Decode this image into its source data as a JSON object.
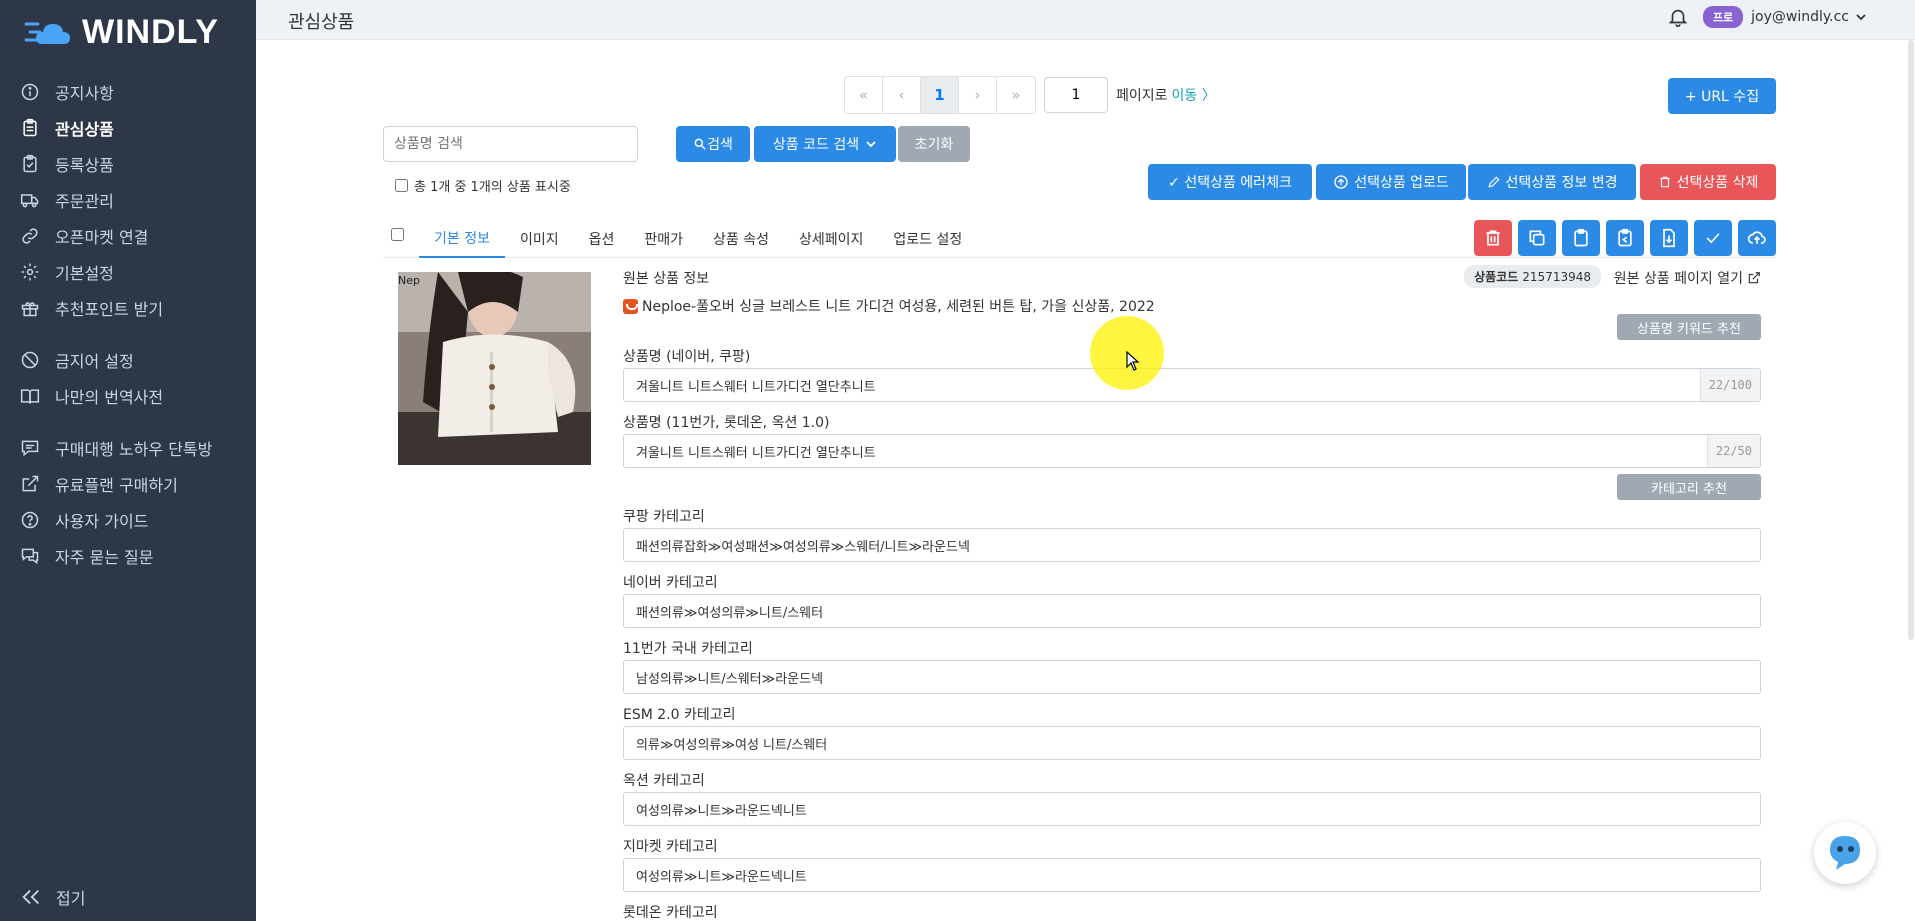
{
  "brand": {
    "logo_text": "WINDLY"
  },
  "sidebar": {
    "items": [
      {
        "label": "공지사항",
        "icon": "info-icon"
      },
      {
        "label": "관심상품",
        "icon": "clipboard-icon",
        "active": true
      },
      {
        "label": "등록상품",
        "icon": "clipboard-check-icon"
      },
      {
        "label": "주문관리",
        "icon": "truck-icon"
      },
      {
        "label": "오픈마켓 연결",
        "icon": "link-icon"
      },
      {
        "label": "기본설정",
        "icon": "gear-icon"
      },
      {
        "label": "추천포인트 받기",
        "icon": "gift-icon"
      },
      {
        "label": "금지어 설정",
        "icon": "ban-icon"
      },
      {
        "label": "나만의 번역사전",
        "icon": "book-icon"
      },
      {
        "label": "구매대행 노하우 단톡방",
        "icon": "chat-icon"
      },
      {
        "label": "유료플랜 구매하기",
        "icon": "external-link-icon"
      },
      {
        "label": "사용자 가이드",
        "icon": "question-icon"
      },
      {
        "label": "자주 묻는 질문",
        "icon": "comments-icon"
      }
    ],
    "collapse_label": "접기"
  },
  "header": {
    "title": "관심상품",
    "badge": "프로",
    "user_email": "joy@windly.cc"
  },
  "pagination": {
    "first": "«",
    "prev": "‹",
    "current": "1",
    "next": "›",
    "last": "»",
    "page_input": "1",
    "page_label": "페이지로",
    "go_label": "이동 〉"
  },
  "toolbar": {
    "url_collect": "+ URL 수집",
    "search_placeholder": "상품명 검색",
    "search_button": "검색",
    "code_search": "상품 코드 검색",
    "reset": "초기화",
    "total_text": "총 1개 중 1개의 상품 표시중",
    "error_check": "✓ 선택상품 에러체크",
    "upload": "선택상품 업로드",
    "edit_info": "선택상품 정보 변경",
    "delete": "선택상품 삭제"
  },
  "tabs": [
    "기본 정보",
    "이미지",
    "옵션",
    "판매가",
    "상품 속성",
    "상세페이지",
    "업로드 설정"
  ],
  "product": {
    "thumb_label": "Nep",
    "original_title": "원본 상품 정보",
    "original_name": "Neploe-풀오버 싱글 브레스트 니트 가디건 여성용, 세련된 버튼 탑, 가을 신상품, 2022",
    "code_label": "상품코드",
    "code_value": "215713948",
    "open_link": "원본 상품 페이지 열기",
    "keyword_btn": "상품명 키워드 추천",
    "category_btn": "카테고리 추천",
    "fields": [
      {
        "label": "상품명 (네이버, 쿠팡)",
        "value": "겨울니트 니트스웨터 니트가디건 열단추니트",
        "counter": "22/100"
      },
      {
        "label": "상품명 (11번가, 롯데온, 옥션 1.0)",
        "value": "겨울니트 니트스웨터 니트가디건 열단추니트",
        "counter": "22/50"
      },
      {
        "label": "쿠팡 카테고리",
        "value": "패션의류잡화≫여성패션≫여성의류≫스웨터/니트≫라운드넥"
      },
      {
        "label": "네이버 카테고리",
        "value": "패션의류≫여성의류≫니트/스웨터"
      },
      {
        "label": "11번가 국내 카테고리",
        "value": "남성의류≫니트/스웨터≫라운드넥"
      },
      {
        "label": "ESM 2.0 카테고리",
        "value": "의류≫여성의류≫여성 니트/스웨터"
      },
      {
        "label": "옥션 카테고리",
        "value": "여성의류≫니트≫라운드넥니트"
      },
      {
        "label": "지마켓 카테고리",
        "value": "여성의류≫니트≫라운드넥니트"
      },
      {
        "label": "롯데온 카테고리",
        "value": ""
      }
    ]
  },
  "colors": {
    "sidebar_bg": "#2d3748",
    "primary": "#2b8ae6",
    "danger": "#e9565a",
    "muted": "#a0a8b3",
    "pro_badge": "#8a63d2"
  }
}
